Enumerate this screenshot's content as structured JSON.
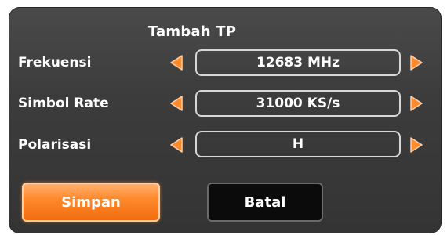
{
  "dialog": {
    "title": "Tambah TP",
    "fields": [
      {
        "label": "Frekuensi",
        "value": "12683 MHz"
      },
      {
        "label": "Simbol Rate",
        "value": "31000 KS/s"
      },
      {
        "label": "Polarisasi",
        "value": "H"
      }
    ],
    "buttons": {
      "save_label": "Simpan",
      "cancel_label": "Batal"
    }
  },
  "colors": {
    "accent_orange": "#ff8a2c",
    "panel_bg": "#3c3c3c",
    "text": "#ffffff"
  },
  "icons": {
    "left": "triangle-left-icon",
    "right": "triangle-right-icon"
  }
}
